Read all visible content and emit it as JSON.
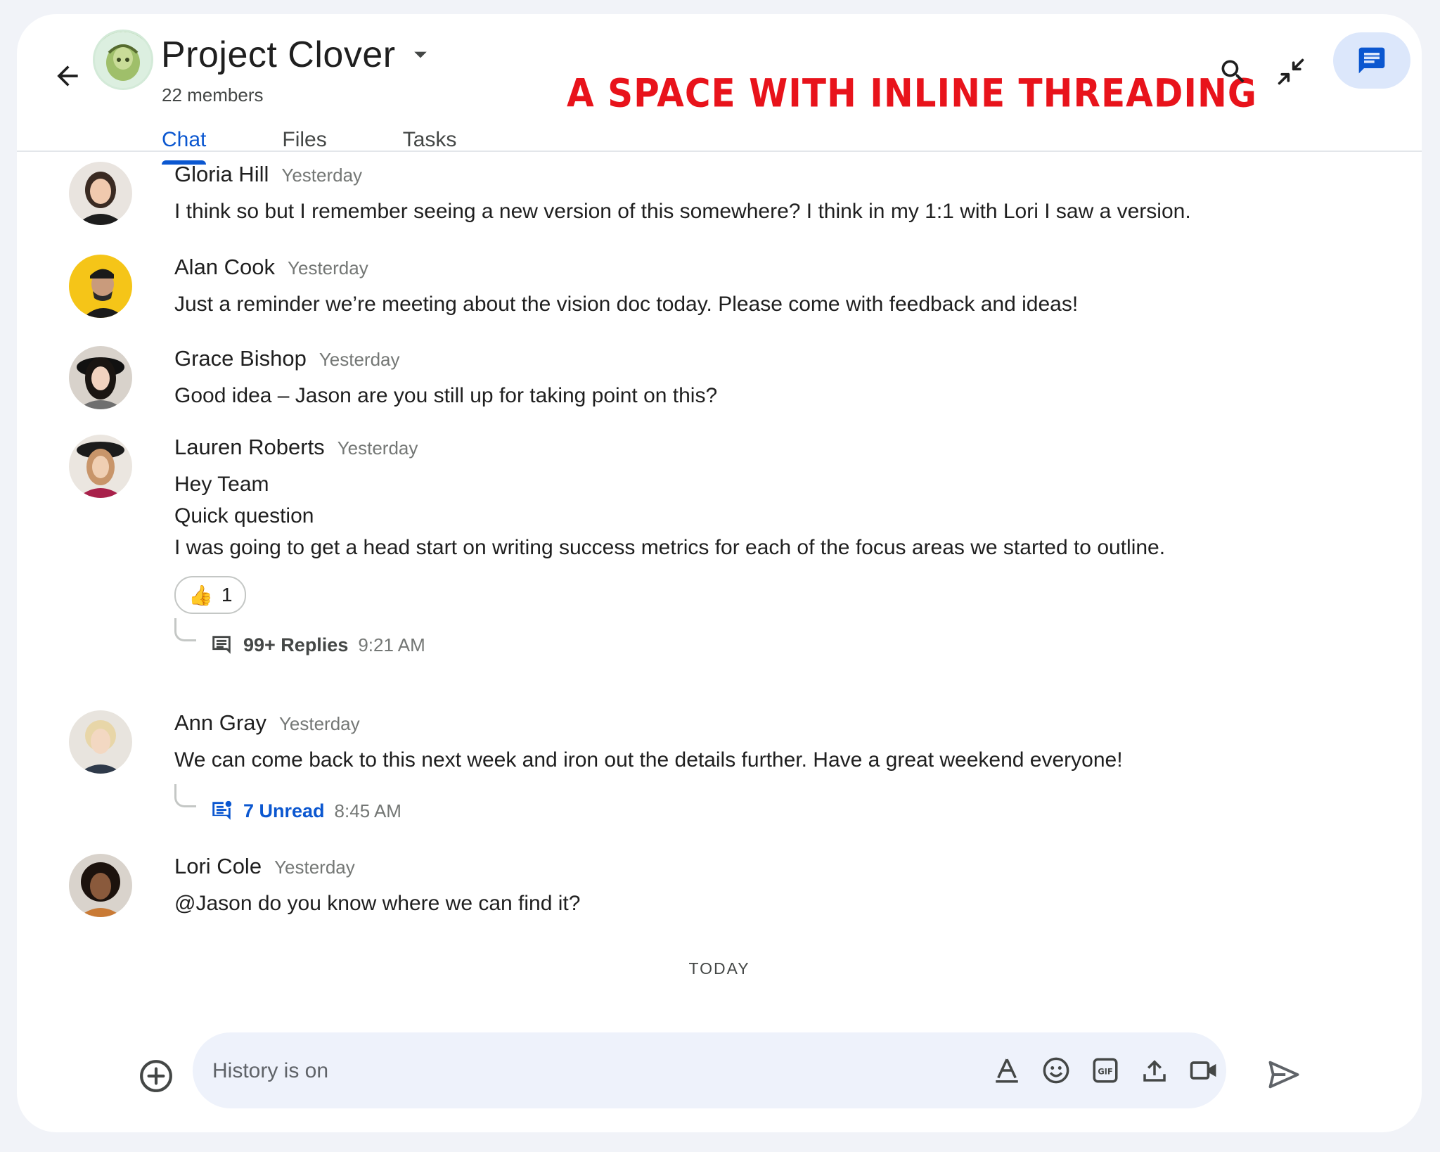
{
  "header": {
    "space_name": "Project Clover",
    "members": "22 members",
    "banner": "A SPACE WITH INLINE THREADING",
    "tabs": [
      {
        "label": "Chat",
        "active": true
      },
      {
        "label": "Files",
        "active": false
      },
      {
        "label": "Tasks",
        "active": false
      }
    ],
    "icons": [
      "back-arrow-icon",
      "caret-down-icon",
      "search-icon",
      "collapse-icon",
      "chat-bubble-icon"
    ]
  },
  "messages": [
    {
      "author": "Gloria Hill",
      "time": "Yesterday",
      "lines": [
        "I think so but I remember seeing a new version of this somewhere? I think in my 1:1 with Lori I saw a version."
      ]
    },
    {
      "author": "Alan Cook",
      "time": "Yesterday",
      "lines": [
        "Just a reminder we’re meeting about the vision doc today. Please come with feedback and ideas!"
      ]
    },
    {
      "author": "Grace Bishop",
      "time": "Yesterday",
      "lines": [
        "Good idea – Jason are you still up for taking point on this?"
      ]
    },
    {
      "author": "Lauren Roberts",
      "time": "Yesterday",
      "lines": [
        "Hey Team",
        "Quick question",
        "I was going to get a head start on writing success metrics for each of the focus areas we started to outline."
      ],
      "reaction": {
        "emoji": "👍",
        "count": "1"
      },
      "thread": {
        "label": "99+ Replies",
        "time": "9:21 AM"
      }
    },
    {
      "author": "Ann Gray",
      "time": "Yesterday",
      "lines": [
        "We can come back to this next week and iron out the details further. Have a great weekend everyone!"
      ],
      "thread": {
        "label": "7 Unread",
        "time": "8:45 AM"
      }
    },
    {
      "author": "Lori Cole",
      "time": "Yesterday",
      "mention": "@Jason",
      "lines": [
        " do you know where we can find it?"
      ]
    }
  ],
  "divider": "TODAY",
  "composer": {
    "placeholder": "History is on",
    "icons": [
      "add-icon",
      "text-format-icon",
      "emoji-icon",
      "gif-icon",
      "upload-icon",
      "video-icon",
      "send-icon"
    ]
  },
  "colors": {
    "accent": "#0b57d0",
    "banner": "#e8131b",
    "composer_bg": "#eef2fb"
  }
}
